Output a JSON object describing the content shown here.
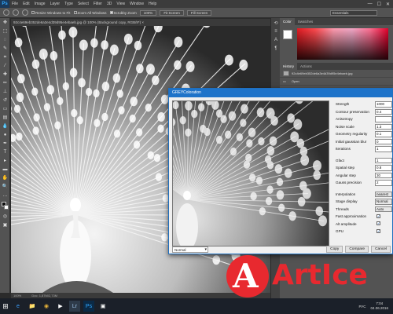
{
  "app": {
    "logo": "Ps",
    "menu": [
      "File",
      "Edit",
      "Image",
      "Layer",
      "Type",
      "Select",
      "Filter",
      "3D",
      "View",
      "Window",
      "Help"
    ],
    "window_controls": [
      "—",
      "☐",
      "✕"
    ]
  },
  "options_bar": {
    "resize_windows": "Resize Windows to Fit",
    "zoom_all_windows": "Zoom All Windows",
    "scrubby_zoom": "Scrubby Zoom",
    "zoom_percent": "100%",
    "fit_screen": "Fit Screen",
    "fill_screen": "Fill Screen",
    "workspace": "Essentials"
  },
  "document": {
    "tab_title": "92c4e69eb352de6a3e4d39d95e4ebaeb.jpg @ 100% (Background copy, RGB/8*) ×",
    "status_zoom": "100%",
    "status_doc": "Doc: 1,87M/2,73M"
  },
  "panels": {
    "color_tabs": [
      "Color",
      "Swatches"
    ],
    "history_tabs": [
      "History",
      "Actions"
    ],
    "history_items": [
      "92c4e69eb352de6a3e4d39d95e4ebaeb.jpg",
      "Open"
    ]
  },
  "dialog": {
    "title": "GREYColoration",
    "params_group1": [
      {
        "label": "Strength",
        "value": "1000"
      },
      {
        "label": "Contour preservation",
        "value": "0.4"
      },
      {
        "label": "Anisotropy",
        "value": ""
      },
      {
        "label": "Noise scale",
        "value": "1.3"
      },
      {
        "label": "Geometry regularity",
        "value": "0.1"
      },
      {
        "label": "Initial gaussian blur",
        "value": "0"
      },
      {
        "label": "Iterations",
        "value": "1"
      }
    ],
    "params_group2": [
      {
        "label": "Gfact",
        "value": "1"
      },
      {
        "label": "Spatial step",
        "value": "0.8"
      },
      {
        "label": "Angular step",
        "value": "30"
      },
      {
        "label": "Gauss precision",
        "value": "2"
      }
    ],
    "selects": [
      {
        "label": "Interpolation",
        "value": "nearest"
      },
      {
        "label": "Stage display",
        "value": "Normal"
      },
      {
        "label": "Threads",
        "value": "Auto"
      }
    ],
    "checks": [
      {
        "label": "Fast approximation",
        "checked": true
      },
      {
        "label": "Alt amplitude",
        "checked": true
      },
      {
        "label": "GPU",
        "checked": true
      }
    ],
    "mode": "Normal",
    "buttons": {
      "copy": "Copy",
      "compare": "Compare",
      "cancel": "Cancel"
    }
  },
  "taskbar": {
    "apps": [
      "e",
      "📁",
      "◉",
      "▶",
      "Lr",
      "Ps",
      "▣"
    ],
    "tray_text": "РУС",
    "time": "7:04",
    "date": "04.06.2016"
  },
  "watermark": {
    "mark": "A",
    "text": "ArtIce"
  }
}
